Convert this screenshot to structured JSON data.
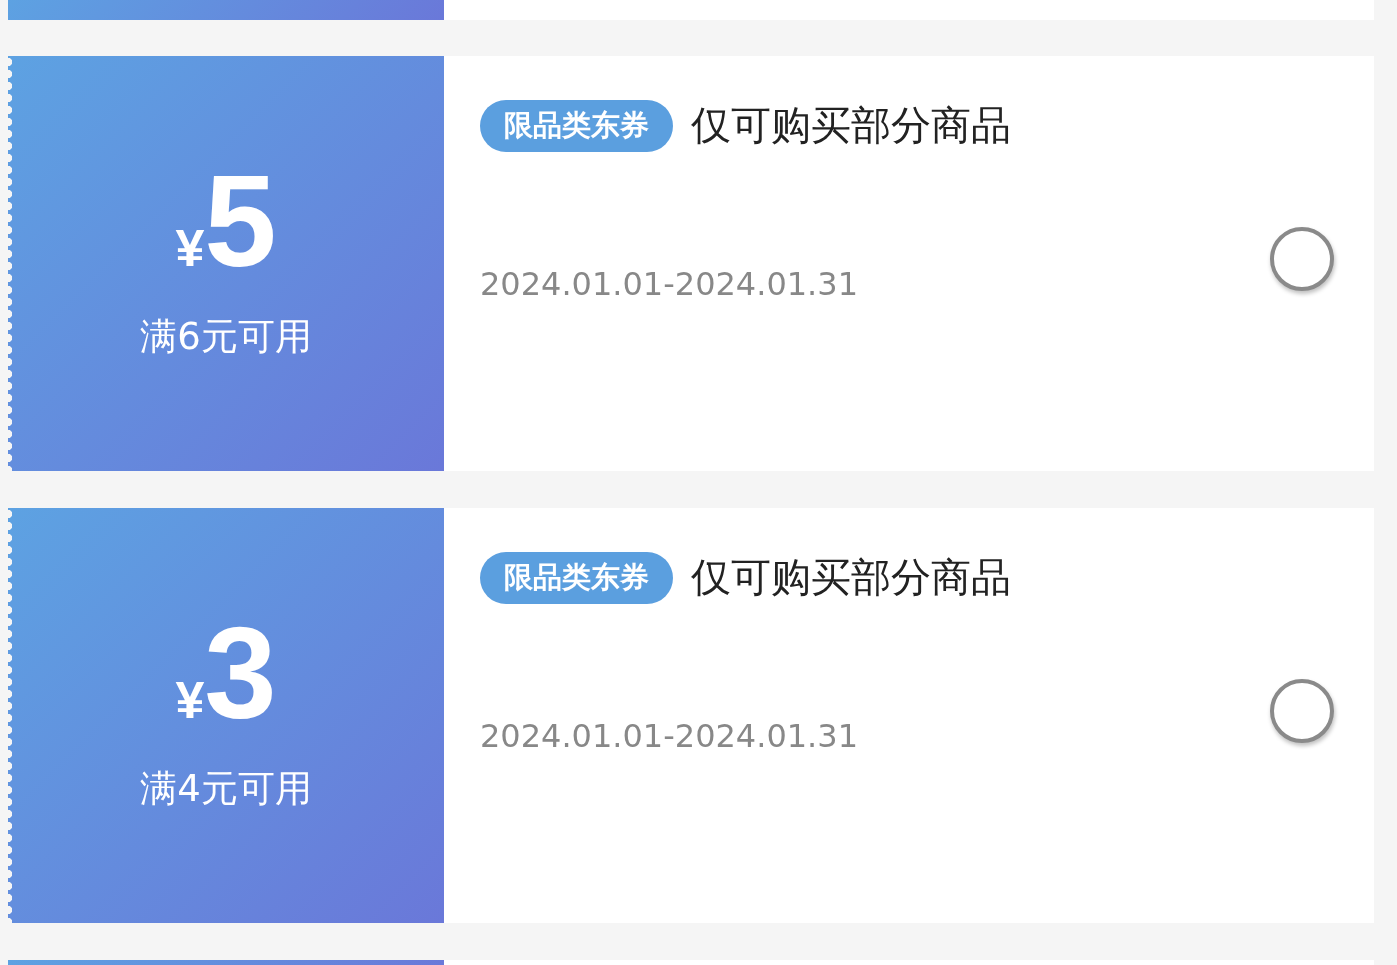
{
  "coupons": [
    {
      "currency": "¥",
      "amount": "5",
      "condition": "满6元可用",
      "tag": "限品类东券",
      "title": "仅可购买部分商品",
      "date": "2024.01.01-2024.01.31",
      "selected": false
    },
    {
      "currency": "¥",
      "amount": "3",
      "condition": "满4元可用",
      "tag": "限品类东券",
      "title": "仅可购买部分商品",
      "date": "2024.01.01-2024.01.31",
      "selected": false
    }
  ]
}
